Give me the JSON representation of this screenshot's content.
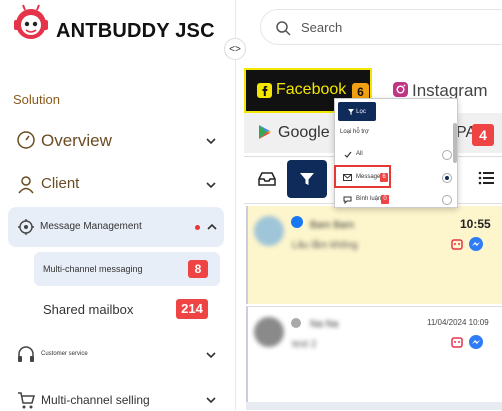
{
  "brand": {
    "name": "ANTBUDDY JSC"
  },
  "sidebar": {
    "section_label": "Solution",
    "items": [
      {
        "label": "Overview",
        "icon": "speedometer-icon"
      },
      {
        "label": "Client",
        "icon": "person-icon"
      },
      {
        "label": "Message Management",
        "icon": "message-cog-icon",
        "dot_color": "#e53935"
      },
      {
        "label": "Customer service",
        "icon": "headset-icon"
      },
      {
        "label": "Multi-channel selling",
        "icon": "cart-icon"
      }
    ],
    "subitems": [
      {
        "label": "Multi-channel messaging",
        "badge": "8"
      },
      {
        "label": "Shared mailbox",
        "badge": "214"
      }
    ]
  },
  "search": {
    "placeholder": "Search"
  },
  "channels": {
    "facebook": {
      "label": "Facebook",
      "badge": "6"
    },
    "instagram": {
      "label": "Instagram"
    },
    "google": {
      "label": "Google"
    },
    "zalo_partial": {
      "label": "PA",
      "badge": "4"
    }
  },
  "filter_dropdown": {
    "button": "Lọc",
    "header": "Loại hỗ trợ",
    "options": [
      {
        "label": "All",
        "selected": false
      },
      {
        "label": "Message",
        "badge": "6",
        "selected": true
      },
      {
        "label": "Bình luận",
        "badge": "0",
        "selected": false
      }
    ]
  },
  "conversations": [
    {
      "name": "Bam Bam",
      "preview": "Lâu lắm không",
      "time": "10:55"
    },
    {
      "name": "Na Na",
      "preview": "test 2",
      "time": "11/04/2024 10:09"
    }
  ],
  "colors": {
    "accent_navy": "#0e2b5a",
    "badge_red": "#ef4444",
    "fb_yellow": "#f3e600",
    "selected_row": "#fdf5cc"
  }
}
